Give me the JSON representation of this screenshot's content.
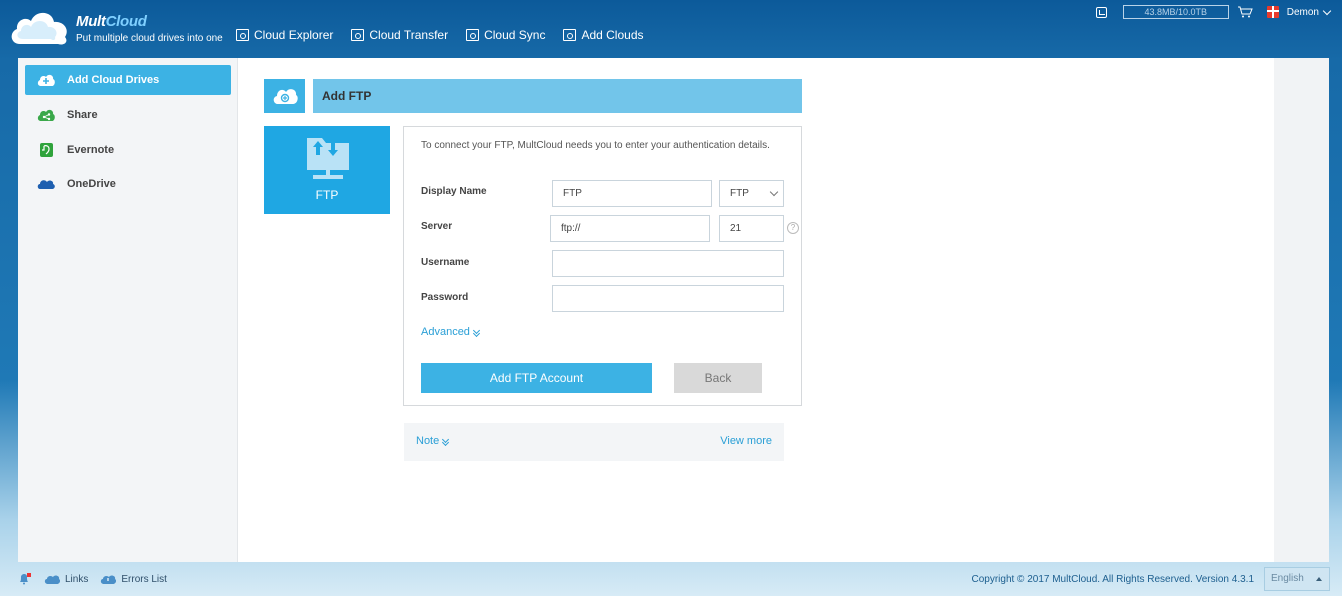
{
  "header": {
    "brand_a": "Mult",
    "brand_b": "Cloud",
    "tagline": "Put multiple cloud drives into one",
    "nav": [
      {
        "label": "Cloud Explorer",
        "icon": "explorer-icon"
      },
      {
        "label": "Cloud Transfer",
        "icon": "transfer-icon"
      },
      {
        "label": "Cloud Sync",
        "icon": "sync-icon"
      },
      {
        "label": "Add Clouds",
        "icon": "add-clouds-icon"
      }
    ],
    "quota": "43.8MB/10.0TB",
    "user": "Demon"
  },
  "sidebar": {
    "items": [
      {
        "label": "Add Cloud Drives",
        "icon": "add-cloud-icon",
        "active": true
      },
      {
        "label": "Share",
        "icon": "share-icon"
      },
      {
        "label": "Evernote",
        "icon": "evernote-icon"
      },
      {
        "label": "OneDrive",
        "icon": "onedrive-icon"
      }
    ]
  },
  "main": {
    "title": "Add FTP",
    "tile_label": "FTP",
    "intro": "To connect your FTP, MultCloud needs you to enter your authentication details.",
    "form": {
      "display_name_label": "Display Name",
      "display_name_value": "FTP",
      "type_select_value": "FTP",
      "server_label": "Server",
      "server_value": "ftp://",
      "port_value": "21",
      "help_glyph": "?",
      "username_label": "Username",
      "username_value": "",
      "password_label": "Password",
      "password_value": "",
      "advanced_label": "Advanced"
    },
    "add_button": "Add FTP Account",
    "back_button": "Back",
    "note_label": "Note",
    "view_more": "View more"
  },
  "footer": {
    "links": "Links",
    "errors": "Errors List",
    "copyright": "Copyright © 2017 MultCloud. All Rights Reserved. Version 4.3.1",
    "language": "English"
  },
  "colors": {
    "accent": "#3cb2e4",
    "tile": "#1fa7e3",
    "title_bar": "#72c5ea",
    "link": "#2a9fd6",
    "header_bg": "#0c5a9a"
  }
}
